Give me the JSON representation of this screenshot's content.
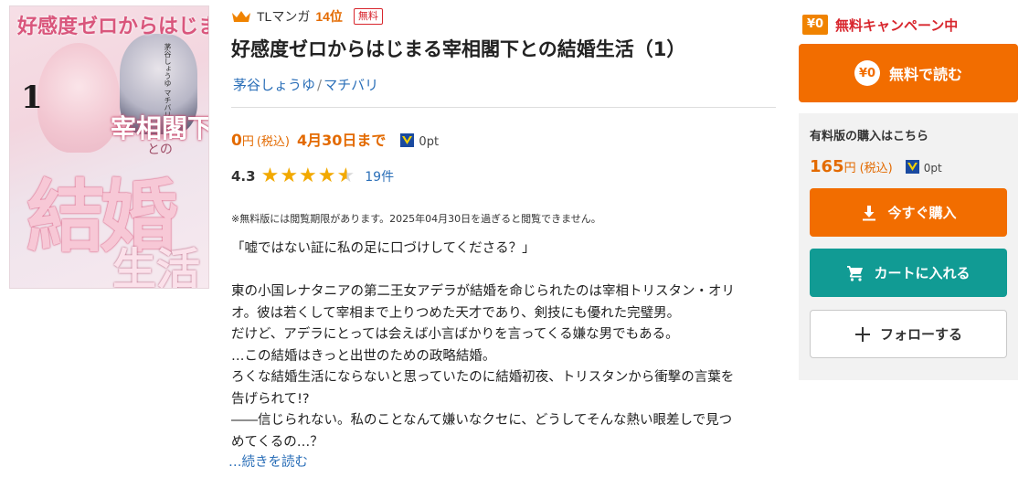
{
  "cover": {
    "title_top": "好感度ゼロからはじまる",
    "volume": "1",
    "subtitle": "宰相閣下",
    "to": "との",
    "big": "結婚",
    "life": "生活",
    "credit": "茅谷しょうゆ マチバリ"
  },
  "ranking": {
    "category": "TLマンガ",
    "position": "14位",
    "badge": "無料"
  },
  "title": "好感度ゼロからはじまる宰相閣下との結婚生活（1）",
  "authors": {
    "author1": "茅谷しょうゆ",
    "separator": "/",
    "author2": "マチバリ"
  },
  "price": {
    "amount": "0",
    "yen": "円",
    "tax": "(税込)",
    "until": "4月30日まで",
    "points": "0pt"
  },
  "rating": {
    "score": "4.3",
    "stars": 4.3,
    "reviews": "19件"
  },
  "note": "※無料版には閲覧期限があります。2025年04月30日を過ぎると閲覧できません。",
  "description": [
    "「嘘ではない証に私の足に口づけしてくださる？」",
    "",
    "東の小国レナタニアの第二王女アデラが結婚を命じられたのは宰相トリスタン・オリ",
    "オ。彼は若くして宰相まで上りつめた天才であり、剣技にも優れた完璧男。",
    "だけど、アデラにとっては会えば小言ばかりを言ってくる嫌な男でもある。",
    "…この結婚はきっと出世のための政略結婚。",
    "ろくな結婚生活にならないと思っていたのに結婚初夜、トリスタンから衝撃の言葉を",
    "告げられて!?",
    "――信じられない。私のことなんて嫌いなクセに、どうしてそんな熱い眼差しで見つ",
    "めてくるの…？"
  ],
  "read_more": "…続きを読む",
  "campaign": {
    "badge": "¥0",
    "text": "無料キャンペーン中"
  },
  "free_button": {
    "icon_text": "¥0",
    "label": "無料で読む"
  },
  "paid": {
    "label": "有料版の購入はこちら",
    "amount": "165",
    "yen": "円",
    "tax": "(税込)",
    "points": "0pt"
  },
  "buttons": {
    "buy": "今すぐ購入",
    "cart": "カートに入れる",
    "follow": "フォローする"
  },
  "colors": {
    "accent_orange": "#f26d00",
    "teal": "#119b94",
    "link_blue": "#2b6fb8",
    "red": "#d8262d"
  }
}
